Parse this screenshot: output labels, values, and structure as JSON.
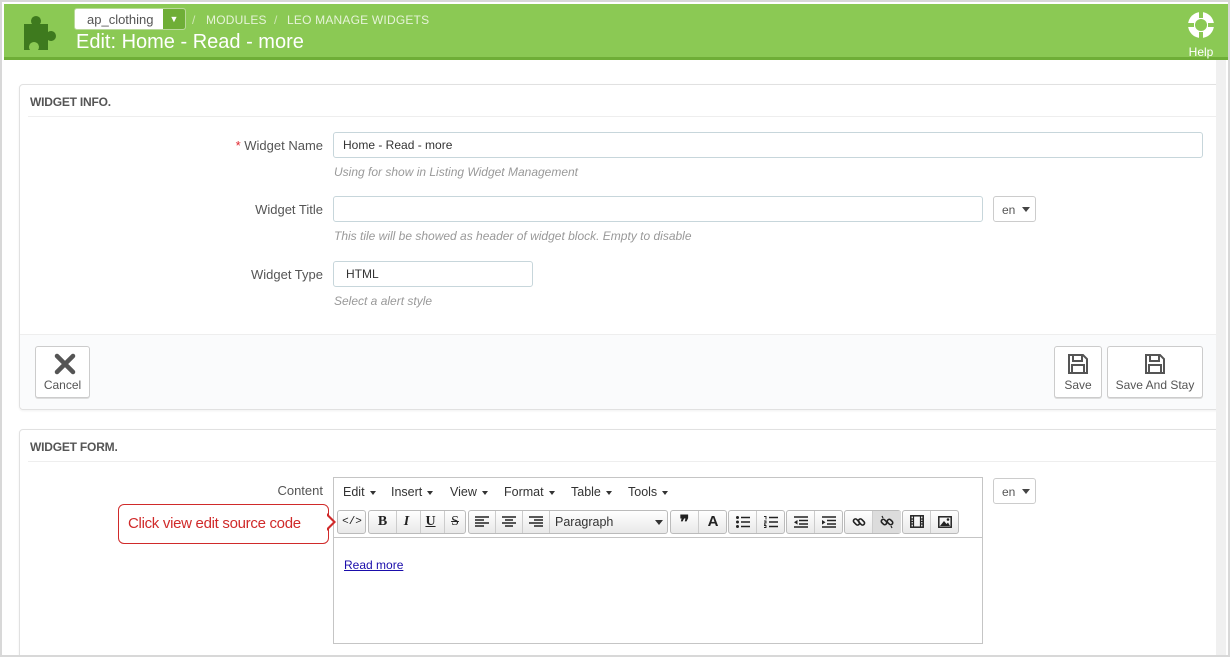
{
  "header": {
    "shop_select_value": "ap_clothing",
    "breadcrumb": [
      "MODULES",
      "LEO MANAGE WIDGETS"
    ],
    "title": "Edit: Home - Read - more",
    "help_label": "Help",
    "bg_color": "#8bc954"
  },
  "widget_info": {
    "heading": "WIDGET INFO.",
    "name_label": "Widget Name",
    "required_mark": "*",
    "name_value": "Home - Read - more",
    "name_hint": "Using for show in Listing Widget Management",
    "title_label": "Widget Title",
    "title_value": "",
    "title_hint": "This tile will be showed as header of widget block. Empty to disable",
    "title_lang": "en",
    "type_label": "Widget Type",
    "type_value": "HTML",
    "type_hint": "Select a alert style"
  },
  "footer": {
    "cancel_label": "Cancel",
    "save_label": "Save",
    "save_stay_label": "Save And Stay"
  },
  "widget_form": {
    "heading": "WIDGET FORM.",
    "content_label": "Content",
    "content_lang": "en",
    "menu": [
      "Edit",
      "Insert",
      "View",
      "Format",
      "Table",
      "Tools"
    ],
    "format_select": "Paragraph",
    "content_link_text": "Read more"
  },
  "callout": {
    "text": "Click view edit source code",
    "color": "#d02a2a"
  }
}
